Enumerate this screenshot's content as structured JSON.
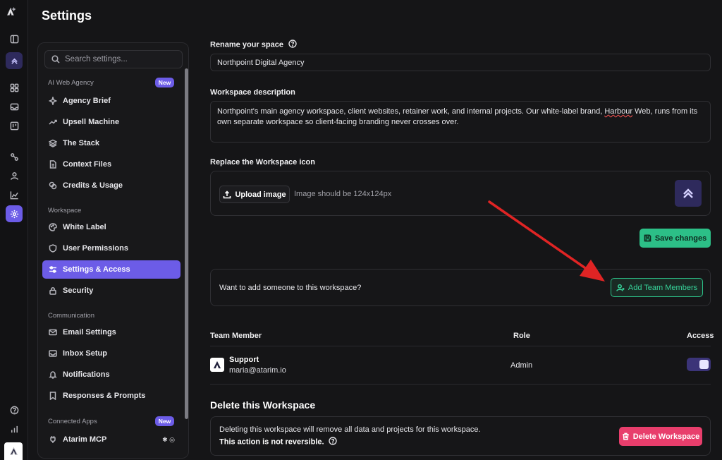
{
  "page": {
    "title": "Settings"
  },
  "rail": {
    "icons": [
      "logo-icon",
      "sidebar-toggle-icon",
      "workspace-brand-icon",
      "dashboard-grid-icon",
      "inbox-icon",
      "board-icon",
      "integrations-icon",
      "user-icon",
      "analytics-icon",
      "settings-icon",
      "help-icon",
      "stats-icon",
      "account-logo-icon"
    ]
  },
  "sidebar": {
    "search_placeholder": "Search settings...",
    "groups": [
      {
        "label": "AI Web Agency",
        "badge": "New",
        "items": [
          {
            "label": "Agency Brief",
            "icon": "sparkles-icon"
          },
          {
            "label": "Upsell Machine",
            "icon": "trend-icon"
          },
          {
            "label": "The Stack",
            "icon": "layers-icon"
          },
          {
            "label": "Context Files",
            "icon": "file-icon"
          },
          {
            "label": "Credits & Usage",
            "icon": "coins-icon"
          }
        ]
      },
      {
        "label": "Workspace",
        "items": [
          {
            "label": "White Label",
            "icon": "palette-icon"
          },
          {
            "label": "User Permissions",
            "icon": "shield-icon"
          },
          {
            "label": "Settings & Access",
            "icon": "sliders-icon",
            "active": true
          },
          {
            "label": "Security",
            "icon": "lock-icon"
          }
        ]
      },
      {
        "label": "Communication",
        "items": [
          {
            "label": "Email Settings",
            "icon": "mail-icon"
          },
          {
            "label": "Inbox Setup",
            "icon": "inbox-icon"
          },
          {
            "label": "Notifications",
            "icon": "bell-icon"
          },
          {
            "label": "Responses & Prompts",
            "icon": "bookmark-icon"
          }
        ]
      },
      {
        "label": "Connected Apps",
        "badge": "New",
        "items": [
          {
            "label": "Atarim MCP",
            "icon": "plug-icon",
            "extra": "✱ ◎"
          }
        ]
      }
    ]
  },
  "main": {
    "rename_label": "Rename your space",
    "space_name": "Northpoint Digital Agency",
    "description_label": "Workspace description",
    "description_part1": "Northpoint's main agency workspace, client websites, retainer work, and internal projects. Our white-label brand, ",
    "description_squiggle": "Harbour",
    "description_part2": " Web, runs from its own separate workspace so client-facing branding never crosses over.",
    "icon_label": "Replace the Workspace icon",
    "upload_button": "Upload image",
    "upload_hint": "Image should be 124x124px",
    "save_button": "Save changes",
    "invite_prompt": "Want to add someone to this workspace?",
    "add_members_button": "Add Team Members",
    "table": {
      "headers": [
        "Team Member",
        "Role",
        "Access"
      ],
      "rows": [
        {
          "name": "Support",
          "email": "maria@atarim.io",
          "role": "Admin",
          "access_enabled": true
        }
      ]
    },
    "delete": {
      "title": "Delete this Workspace",
      "warning": "Deleting this workspace will remove all data and projects for this workspace.",
      "irreversible": "This action is not reversible.",
      "button": "Delete Workspace"
    }
  },
  "colors": {
    "accent": "#6c5ce7",
    "success": "#2cbf87",
    "danger": "#e83e6c",
    "annotation_arrow": "#e02424"
  }
}
